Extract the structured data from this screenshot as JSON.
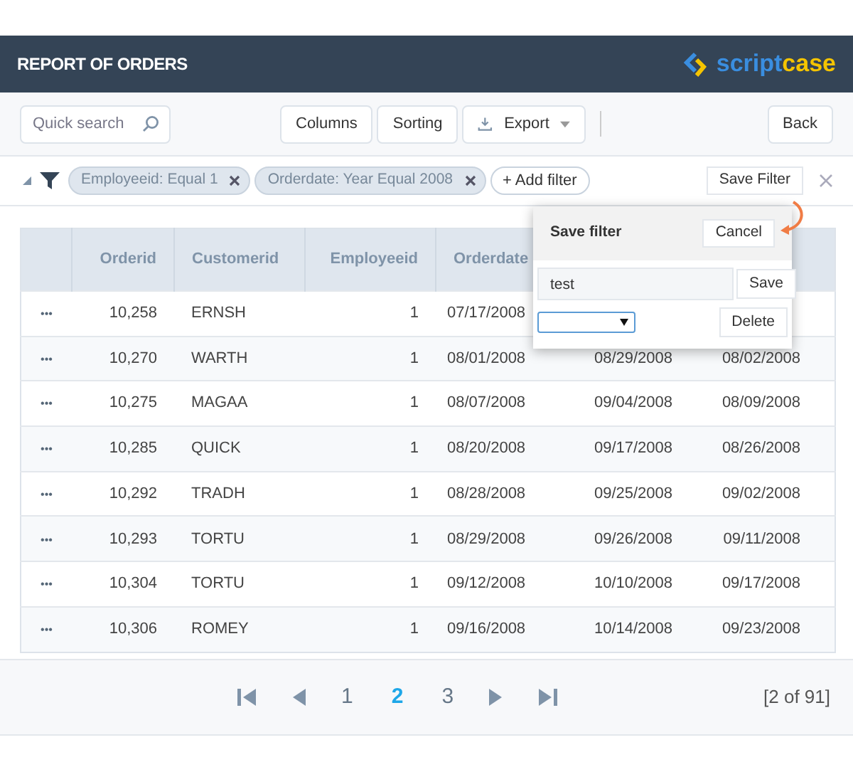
{
  "header": {
    "title": "REPORT OF ORDERS",
    "logo": {
      "part_1": "script",
      "part_2": "case"
    }
  },
  "toolbar": {
    "search": {
      "placeholder": "Quick search"
    },
    "buttons": [
      {
        "label": "Columns",
        "kind": "plain"
      },
      {
        "label": "Sorting",
        "kind": "plain"
      },
      {
        "label": "Export",
        "kind": "export"
      }
    ],
    "back": "Back"
  },
  "filters": {
    "expanded": true,
    "chips": [
      "Employeeid: Equal 1",
      "Orderdate: Year Equal 2008"
    ],
    "add": "+ Add filter",
    "save": "Save Filter"
  },
  "table": {
    "columns": [
      "Orderid",
      "Customerid",
      "Employeeid",
      "Orderdate"
    ],
    "rows": [
      {
        "menu": "•••",
        "orderid": "10,258",
        "customerid": "ERNSH",
        "employeeid": "1",
        "orderdate": "07/17/2008"
      },
      {
        "menu": "•••",
        "orderid": "10,270",
        "customerid": "WARTH",
        "employeeid": "1",
        "orderdate": "08/01/2008",
        "column_6": "08/29/2008",
        "column_7": "08/02/2008"
      },
      {
        "menu": "•••",
        "orderid": "10,275",
        "customerid": "MAGAA",
        "employeeid": "1",
        "orderdate": "08/07/2008",
        "column_6": "09/04/2008",
        "column_7": "08/09/2008"
      },
      {
        "menu": "•••",
        "orderid": "10,285",
        "customerid": "QUICK",
        "employeeid": "1",
        "orderdate": "08/20/2008",
        "column_6": "09/17/2008",
        "column_7": "08/26/2008"
      },
      {
        "menu": "•••",
        "orderid": "10,292",
        "customerid": "TRADH",
        "employeeid": "1",
        "orderdate": "08/28/2008",
        "column_6": "09/25/2008",
        "column_7": "09/02/2008"
      },
      {
        "menu": "•••",
        "orderid": "10,293",
        "customerid": "TORTU",
        "employeeid": "1",
        "orderdate": "08/29/2008",
        "column_6": "09/26/2008",
        "column_7": "09/11/2008"
      },
      {
        "menu": "•••",
        "orderid": "10,304",
        "customerid": "TORTU",
        "employeeid": "1",
        "orderdate": "09/12/2008",
        "column_6": "10/10/2008",
        "column_7": "09/17/2008"
      },
      {
        "menu": "•••",
        "orderid": "10,306",
        "customerid": "ROMEY",
        "employeeid": "1",
        "orderdate": "09/16/2008",
        "column_6": "10/14/2008",
        "column_7": "09/23/2008"
      }
    ]
  },
  "save_filter_popup": {
    "title": "Save filter",
    "cancel": "Cancel",
    "name_value": "test",
    "save": "Save",
    "delete": "Delete"
  },
  "pagination": {
    "pages": [
      {
        "label": "1",
        "selected": false
      },
      {
        "label": "2",
        "selected": true
      },
      {
        "label": "3",
        "selected": false
      }
    ],
    "summary": "[2 of 91]"
  }
}
